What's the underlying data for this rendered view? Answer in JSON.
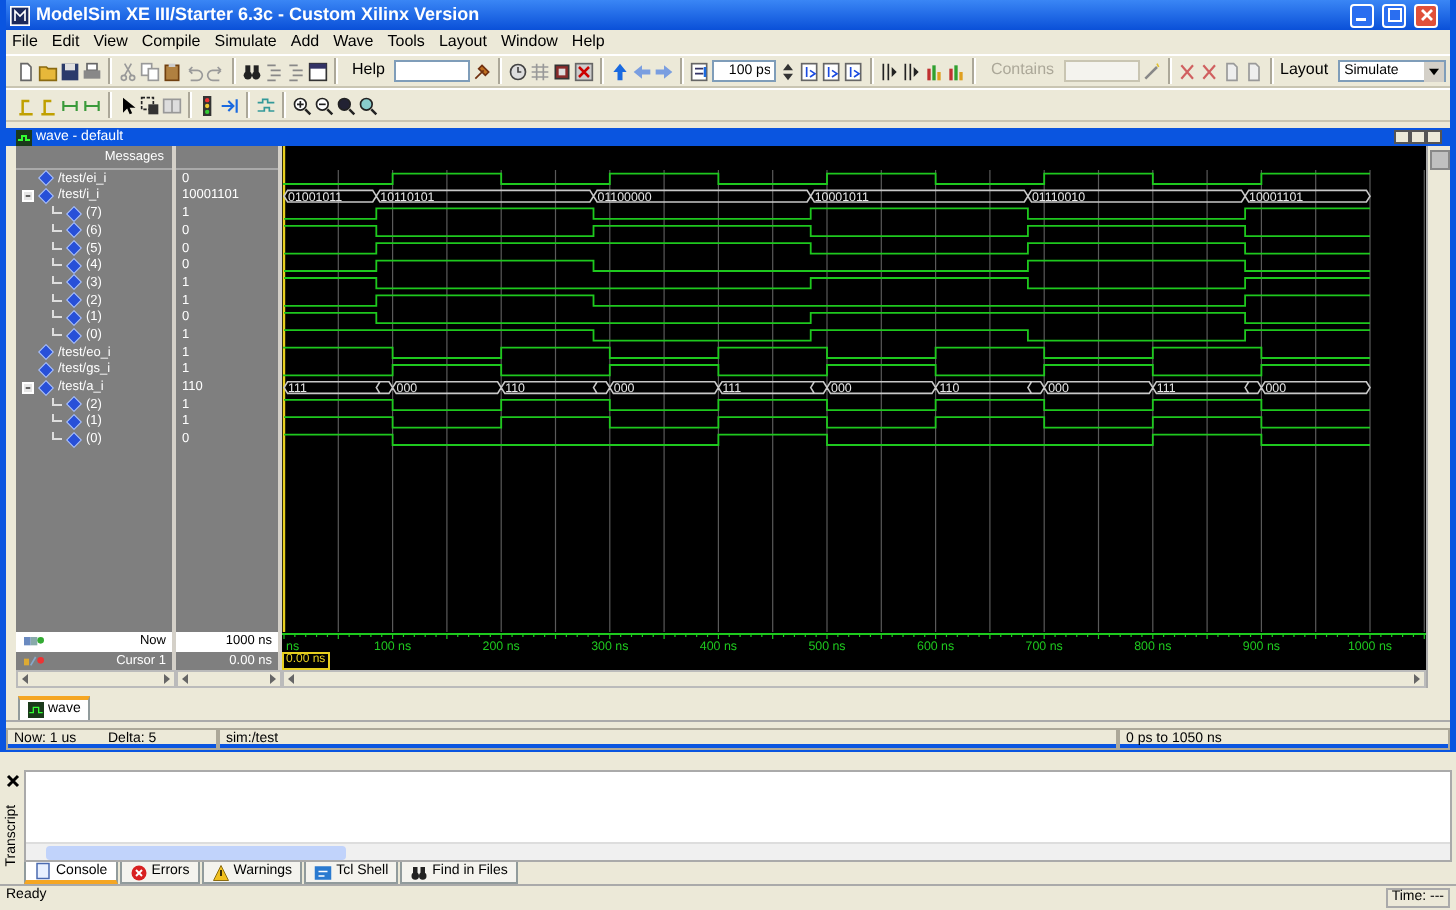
{
  "window": {
    "title": "ModelSim XE III/Starter 6.3c - Custom Xilinx Version"
  },
  "menu": [
    "File",
    "Edit",
    "View",
    "Compile",
    "Simulate",
    "Add",
    "Wave",
    "Tools",
    "Layout",
    "Window",
    "Help"
  ],
  "toolbar": {
    "help_label": "Help",
    "time_step": "100 ps",
    "contains_label": "Contains",
    "layout_label": "Layout",
    "layout_value": "Simulate"
  },
  "wave_window": {
    "title": "wave - default",
    "header": "Messages",
    "signals": [
      {
        "name": "/test/ei_i",
        "value": "0",
        "kind": "bit",
        "high": [
          false,
          true,
          false,
          true,
          false,
          true,
          false,
          true,
          false,
          true
        ]
      },
      {
        "name": "/test/i_i",
        "value": "10001101",
        "kind": "bus",
        "expanded": true,
        "segments": [
          "01001011",
          "10110101",
          "01100000",
          "10001011",
          "01110010",
          "10001101"
        ],
        "children": [
          {
            "name": "(7)",
            "value": "1"
          },
          {
            "name": "(6)",
            "value": "0"
          },
          {
            "name": "(5)",
            "value": "0"
          },
          {
            "name": "(4)",
            "value": "0"
          },
          {
            "name": "(3)",
            "value": "1"
          },
          {
            "name": "(2)",
            "value": "1"
          },
          {
            "name": "(1)",
            "value": "0"
          },
          {
            "name": "(0)",
            "value": "1"
          }
        ]
      },
      {
        "name": "/test/eo_i",
        "value": "1",
        "kind": "bit",
        "high": [
          true,
          false,
          true,
          false,
          true,
          false,
          true,
          false,
          true,
          false
        ]
      },
      {
        "name": "/test/gs_i",
        "value": "1",
        "kind": "bit",
        "high": [
          false,
          true,
          false,
          true,
          false,
          true,
          false,
          true,
          false,
          true
        ]
      },
      {
        "name": "/test/a_i",
        "value": "110",
        "kind": "bus",
        "expanded": true,
        "segments": [
          "111",
          "000",
          "110",
          "000",
          "111",
          "000",
          "110",
          "000",
          "111",
          "000"
        ],
        "children": [
          {
            "name": "(2)",
            "value": "1"
          },
          {
            "name": "(1)",
            "value": "1"
          },
          {
            "name": "(0)",
            "value": "0"
          }
        ]
      }
    ],
    "now_label": "Now",
    "now_value": "1000 ns",
    "cursor_label": "Cursor 1",
    "cursor_value": "0.00 ns",
    "cursor_time": "0.00 ns",
    "axis_labels": [
      "ns",
      "100 ns",
      "200 ns",
      "300 ns",
      "400 ns",
      "500 ns",
      "600 ns",
      "700 ns",
      "800 ns",
      "900 ns",
      "1000 ns"
    ]
  },
  "window_tabs": [
    {
      "label": "wave",
      "selected": true
    }
  ],
  "status_bar": [
    "Now: 1 us",
    "Delta: 5",
    "sim:/test",
    "0 ps to 1050 ns"
  ],
  "transcript": {
    "title": "Transcript",
    "tabs": [
      {
        "label": "Console",
        "selected": true
      },
      {
        "label": "Errors",
        "selected": false
      },
      {
        "label": "Warnings",
        "selected": false
      },
      {
        "label": "Tcl Shell",
        "selected": false
      },
      {
        "label": "Find in Files",
        "selected": false
      }
    ]
  },
  "app_status": {
    "message": "Ready",
    "time": "Time: ---"
  }
}
